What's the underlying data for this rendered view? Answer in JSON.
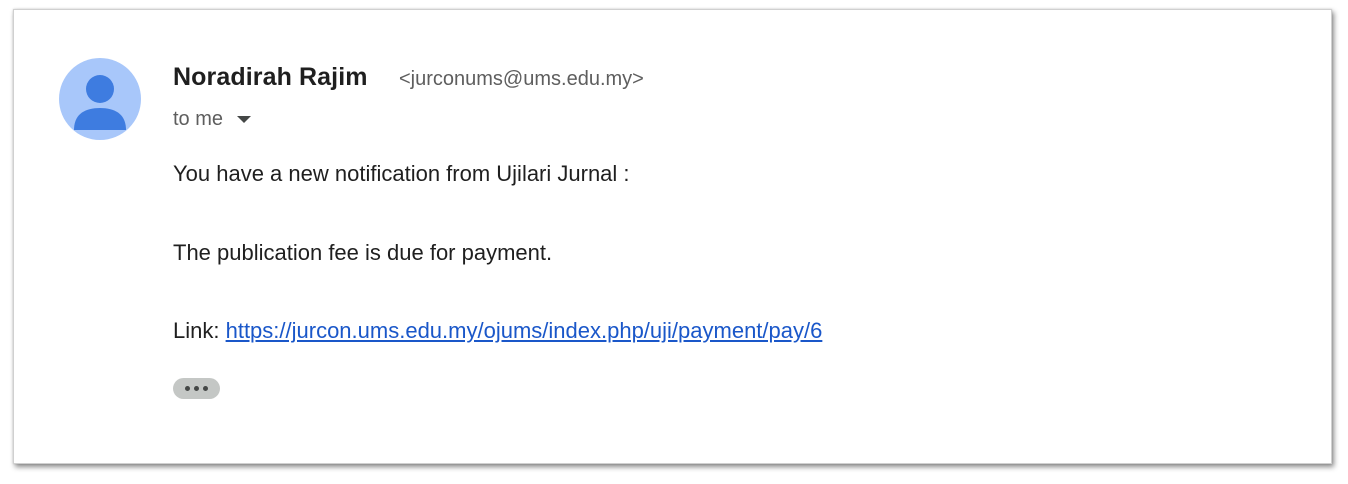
{
  "email": {
    "sender": {
      "name": "Noradirah Rajim",
      "address": "<jurconums@ums.edu.my>"
    },
    "recipient_label": "to me",
    "body": {
      "line1": "You have a new notification from Ujilari Jurnal :",
      "line2": "The publication fee is due for payment.",
      "link_prefix": "Link: ",
      "link_url": "https://jurcon.ums.edu.my/ojums/index.php/uji/payment/pay/6"
    },
    "icons": {
      "avatar": "default-person-avatar-icon",
      "recipient_details": "caret-down-icon",
      "show_trimmed": "ellipsis-icon"
    },
    "colors": {
      "avatar_bg": "#a8c7fa",
      "avatar_fg": "#3e7ce0",
      "link": "#1a57c9"
    }
  }
}
